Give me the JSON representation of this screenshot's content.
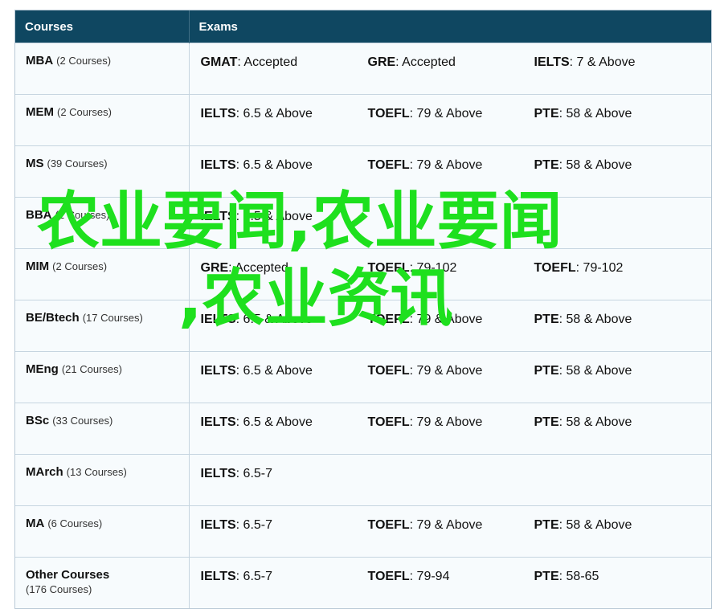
{
  "header": {
    "courses": "Courses",
    "exams": "Exams"
  },
  "rows": [
    {
      "course": "MBA",
      "count": "(2 Courses)",
      "exams": [
        {
          "name": "GMAT",
          "value": ": Accepted"
        },
        {
          "name": "GRE",
          "value": ": Accepted"
        },
        {
          "name": "IELTS",
          "value": ": 7 & Above"
        }
      ]
    },
    {
      "course": "MEM",
      "count": "(2 Courses)",
      "exams": [
        {
          "name": "IELTS",
          "value": ": 6.5 & Above"
        },
        {
          "name": "TOEFL",
          "value": ": 79 & Above"
        },
        {
          "name": "PTE",
          "value": ": 58 & Above"
        }
      ]
    },
    {
      "course": "MS",
      "count": "(39 Courses)",
      "exams": [
        {
          "name": "IELTS",
          "value": ": 6.5 & Above"
        },
        {
          "name": "TOEFL",
          "value": ": 79 & Above"
        },
        {
          "name": "PTE",
          "value": ": 58 & Above"
        }
      ]
    },
    {
      "course": "BBA",
      "count": "(2 Courses)",
      "exams": [
        {
          "name": "IELTS",
          "value": ": 6.5 & Above"
        },
        {
          "name": "",
          "value": ""
        },
        {
          "name": "",
          "value": ""
        }
      ]
    },
    {
      "course": "MIM",
      "count": "(2 Courses)",
      "exams": [
        {
          "name": "GRE",
          "value": ": Accepted"
        },
        {
          "name": "TOEFL",
          "value": ": 79-102"
        },
        {
          "name": "TOEFL",
          "value": ": 79-102"
        }
      ]
    },
    {
      "course": "BE/Btech",
      "count": "(17 Courses)",
      "exams": [
        {
          "name": "IELTS",
          "value": ": 6.5 & Above"
        },
        {
          "name": "TOEFL",
          "value": ": 79 & Above"
        },
        {
          "name": "PTE",
          "value": ": 58 & Above"
        }
      ]
    },
    {
      "course": "MEng",
      "count": "(21 Courses)",
      "exams": [
        {
          "name": "IELTS",
          "value": ": 6.5 & Above"
        },
        {
          "name": "TOEFL",
          "value": ": 79 & Above"
        },
        {
          "name": "PTE",
          "value": ": 58 & Above"
        }
      ]
    },
    {
      "course": "BSc",
      "count": "(33 Courses)",
      "exams": [
        {
          "name": "IELTS",
          "value": ": 6.5 & Above"
        },
        {
          "name": "TOEFL",
          "value": ": 79 & Above"
        },
        {
          "name": "PTE",
          "value": ": 58 & Above"
        }
      ]
    },
    {
      "course": "MArch",
      "count": "(13 Courses)",
      "exams": [
        {
          "name": "IELTS",
          "value": ": 6.5-7"
        },
        {
          "name": "",
          "value": ""
        },
        {
          "name": "",
          "value": ""
        }
      ]
    },
    {
      "course": "MA",
      "count": "(6 Courses)",
      "exams": [
        {
          "name": "IELTS",
          "value": ": 6.5-7"
        },
        {
          "name": "TOEFL",
          "value": ": 79 & Above"
        },
        {
          "name": "PTE",
          "value": ": 58 & Above"
        }
      ]
    },
    {
      "course": "Other Courses",
      "count": "(176 Courses)",
      "exams": [
        {
          "name": "IELTS",
          "value": ": 6.5-7"
        },
        {
          "name": "TOEFL",
          "value": ": 79-94"
        },
        {
          "name": "PTE",
          "value": ": 58-65"
        }
      ]
    }
  ],
  "watermark": {
    "line1": "农业要闻,农业要闻",
    "line2": ",农业资讯",
    "color": "#1ee01e"
  }
}
